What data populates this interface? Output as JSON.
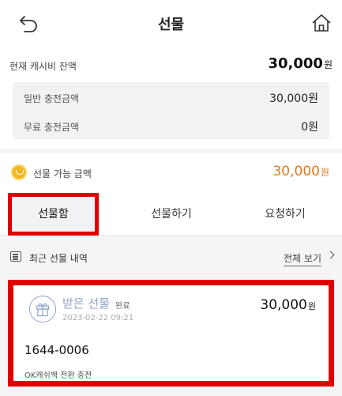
{
  "header": {
    "title": "선물",
    "back_icon": "back-arrow-icon",
    "home_icon": "home-icon"
  },
  "balance": {
    "label": "현재 캐시비 잔액",
    "amount": "30,000",
    "unit": "원",
    "general_label": "일반 충전금액",
    "general_value": "30,000원",
    "free_label": "무료 충전금액",
    "free_value": "0원"
  },
  "giftable": {
    "label": "선물 가능 금액",
    "amount": "30,000",
    "unit": "원",
    "icon": "coin-icon",
    "color": "#e0791e"
  },
  "tabs": [
    {
      "label": "선물함",
      "active": true
    },
    {
      "label": "선물하기",
      "active": false
    },
    {
      "label": "요청하기",
      "active": false
    }
  ],
  "recent": {
    "label": "최근 선물 내역",
    "view_all": "전체 보기"
  },
  "history": [
    {
      "title": "받은 선물",
      "status": "완료",
      "date": "2023-02-22 09:21",
      "amount": "30,000",
      "unit": "원",
      "number": "1644-0006",
      "description": "OK캐쉬백 전환 충전"
    }
  ],
  "colors": {
    "accent": "#e0791e",
    "highlight": "#e00000",
    "gift_blue": "#8fa3c9"
  }
}
